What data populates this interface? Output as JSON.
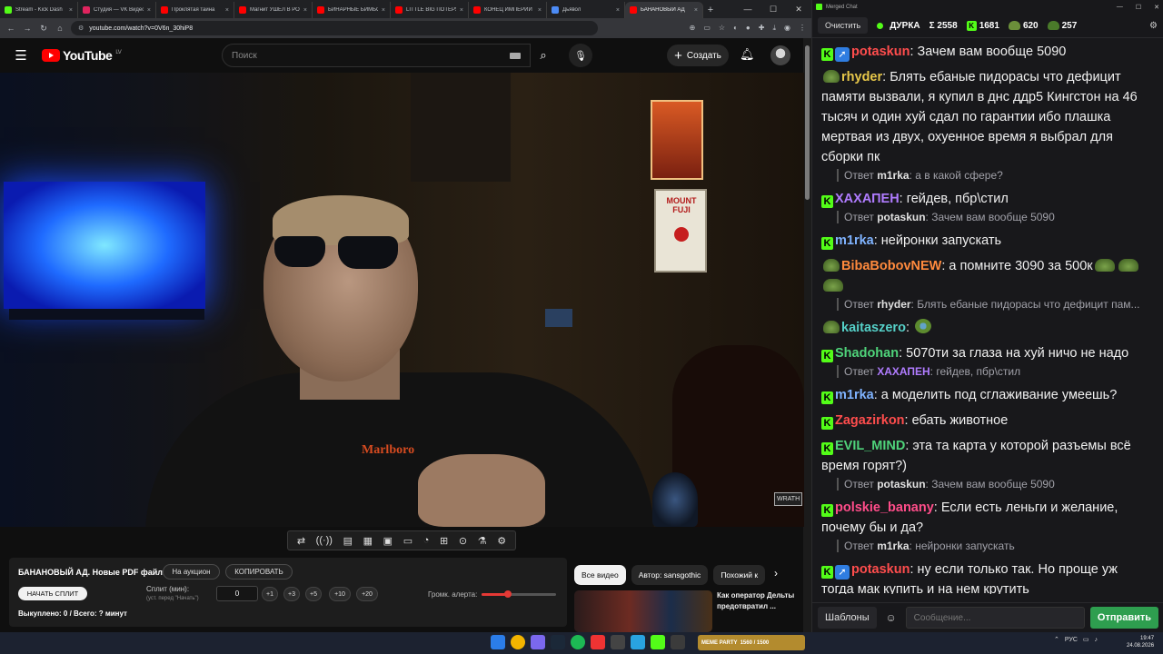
{
  "browser": {
    "tabs": [
      {
        "label": "Stream - Kick Dash",
        "color": "#53fc18"
      },
      {
        "label": "Студия — VK Видео",
        "color": "#e0245e"
      },
      {
        "label": "Проклятая тайна",
        "color": "#ff0000"
      },
      {
        "label": "Магнит УШЁЛ В РО",
        "color": "#ff0000"
      },
      {
        "label": "БИНАРНЫЕ БИМБО",
        "color": "#ff0000"
      },
      {
        "label": "LITTLE BIG ПОТЕРЯ",
        "color": "#ff0000"
      },
      {
        "label": "КОНЕЦ ИМПЕРИИ",
        "color": "#ff0000"
      },
      {
        "label": "Дьявол",
        "color": "#4c8bf5"
      },
      {
        "label": "БАНАНОВЫЙ АД",
        "color": "#ff0000"
      }
    ],
    "new_tab": "+",
    "url": "youtube.com/watch?v=0V6n_30hiP8"
  },
  "youtube": {
    "logo_text": "YouTube",
    "region": "LV",
    "search_placeholder": "Поиск",
    "create_label": "Создать",
    "player_tools": [
      "⇄",
      "((·))",
      "▤",
      "▦",
      "▣",
      "▭",
      "◔",
      "⊞",
      "⊙",
      "⚗",
      "⚙"
    ]
  },
  "video": {
    "shirt_text": "Marlboro",
    "corner_logo": "WRATH",
    "poster_text": "MOUNT FUJI"
  },
  "split_panel": {
    "title": "БАНАНОВЫЙ АД. Новые PDF файлы.",
    "auction_btn": "На аукцион",
    "copy_btn": "КОПИРОВАТЬ",
    "start_btn": "НАЧАТЬ СПЛИТ",
    "split_label": "Сплит (мин):",
    "split_hint": "(уст. перед \"Начать\")",
    "split_value": "0",
    "steps": [
      "+1",
      "+3",
      "+5",
      "+10",
      "+20"
    ],
    "volume_label": "Громк. алерта:",
    "volume_level": 0.35,
    "bought": "Выкуплено: 0 / Всего: ? минут"
  },
  "recommendations": {
    "chips": [
      "Все видео",
      "Автор: sansgothic",
      "Похожий к"
    ],
    "next_icon": "›",
    "first_title": "Как оператор Дельты предотвратил ..."
  },
  "chat": {
    "window_title": "Merged Chat",
    "clear_btn": "Очистить",
    "channel": "ДУРКА",
    "total": "Σ 2558",
    "kick_count": "1681",
    "pepe_count": "620",
    "other_count": "257",
    "messages": [
      {
        "badges": [
          "k",
          "arrow"
        ],
        "user": "potaskun",
        "color": "#ff4d4d",
        "text": "Зачем вам вообще 5090"
      },
      {
        "badges": [
          "pe"
        ],
        "user": "rhyder",
        "color": "#e8c84a",
        "text": "Блять ебаные пидорасы что дефицит памяти вызвали, я купил в днс ддр5 Кингстон на 46 тысяч и один хуй сдал по гарантии ибо плашка мертвая из двух, охуенное время я выбрал для сборки пк"
      },
      {
        "reply": true,
        "ruser": "m1rka",
        "rcolor": "#e0e0e0",
        "rtext": "а в какой сфере?"
      },
      {
        "badges": [
          "k"
        ],
        "user": "ХАХАПЕН",
        "color": "#b07cff",
        "text": "гейдев, пбр\\стил"
      },
      {
        "reply": true,
        "ruser": "potaskun",
        "rcolor": "#e0e0e0",
        "rtext": "Зачем вам вообще 5090"
      },
      {
        "badges": [
          "k"
        ],
        "user": "m1rka",
        "color": "#7fb3ff",
        "text": "нейронки запускать"
      },
      {
        "badges": [
          "pe"
        ],
        "user": "BibaBobovNEW",
        "color": "#ff8a3d",
        "text": "а помните 3090 за 500к",
        "emotes": 3
      },
      {
        "reply": true,
        "ruser": "rhyder",
        "rcolor": "#e0e0e0",
        "rtext": "Блять ебаные пидорасы что дефицит пам..."
      },
      {
        "badges": [
          "pe"
        ],
        "user": "kaitaszero",
        "color": "#55d0c8",
        "text": "",
        "emotes_sad": 1
      },
      {
        "badges": [
          "k"
        ],
        "user": "Shadohan",
        "color": "#4fd37a",
        "text": "5070ти за глаза на хуй ничо не надо"
      },
      {
        "reply": true,
        "ruser": "ХАХАПЕН",
        "rcolor": "#b07cff",
        "rtext": "гейдев, пбр\\стил"
      },
      {
        "badges": [
          "k"
        ],
        "user": "m1rka",
        "color": "#7fb3ff",
        "text": "а моделить под сглаживание умеешь?"
      },
      {
        "badges": [
          "k"
        ],
        "user": "Zagazirkon",
        "color": "#ff4d4d",
        "text": "ебать животное"
      },
      {
        "badges": [
          "k"
        ],
        "user": "EVIL_MIND",
        "color": "#4fd37a",
        "text": "эта та карта у которой разъемы всё время горят?)"
      },
      {
        "reply": true,
        "ruser": "potaskun",
        "rcolor": "#e0e0e0",
        "rtext": "Зачем вам вообще 5090"
      },
      {
        "badges": [
          "k"
        ],
        "user": "polskie_banany",
        "color": "#ff4d8a",
        "text": "Если есть леньги и желание, почему бы и да?"
      },
      {
        "reply": true,
        "ruser": "m1rka",
        "rcolor": "#e0e0e0",
        "rtext": "нейронки запускать"
      },
      {
        "badges": [
          "k",
          "arrow"
        ],
        "user": "potaskun",
        "color": "#ff4d4d",
        "text": "ну если только так. Но проще уж тогда мак купить и на нем крутить"
      }
    ],
    "reply_prefix": "Ответ",
    "templates_btn": "Шаблоны",
    "input_placeholder": "Сообщение...",
    "send_btn": "Отправить"
  },
  "taskbar": {
    "widget_text": "MEME PARTY",
    "widget_sub": "1560 / 1500",
    "lang": "РУС",
    "time": "19:47",
    "date": "24.08.2026"
  }
}
